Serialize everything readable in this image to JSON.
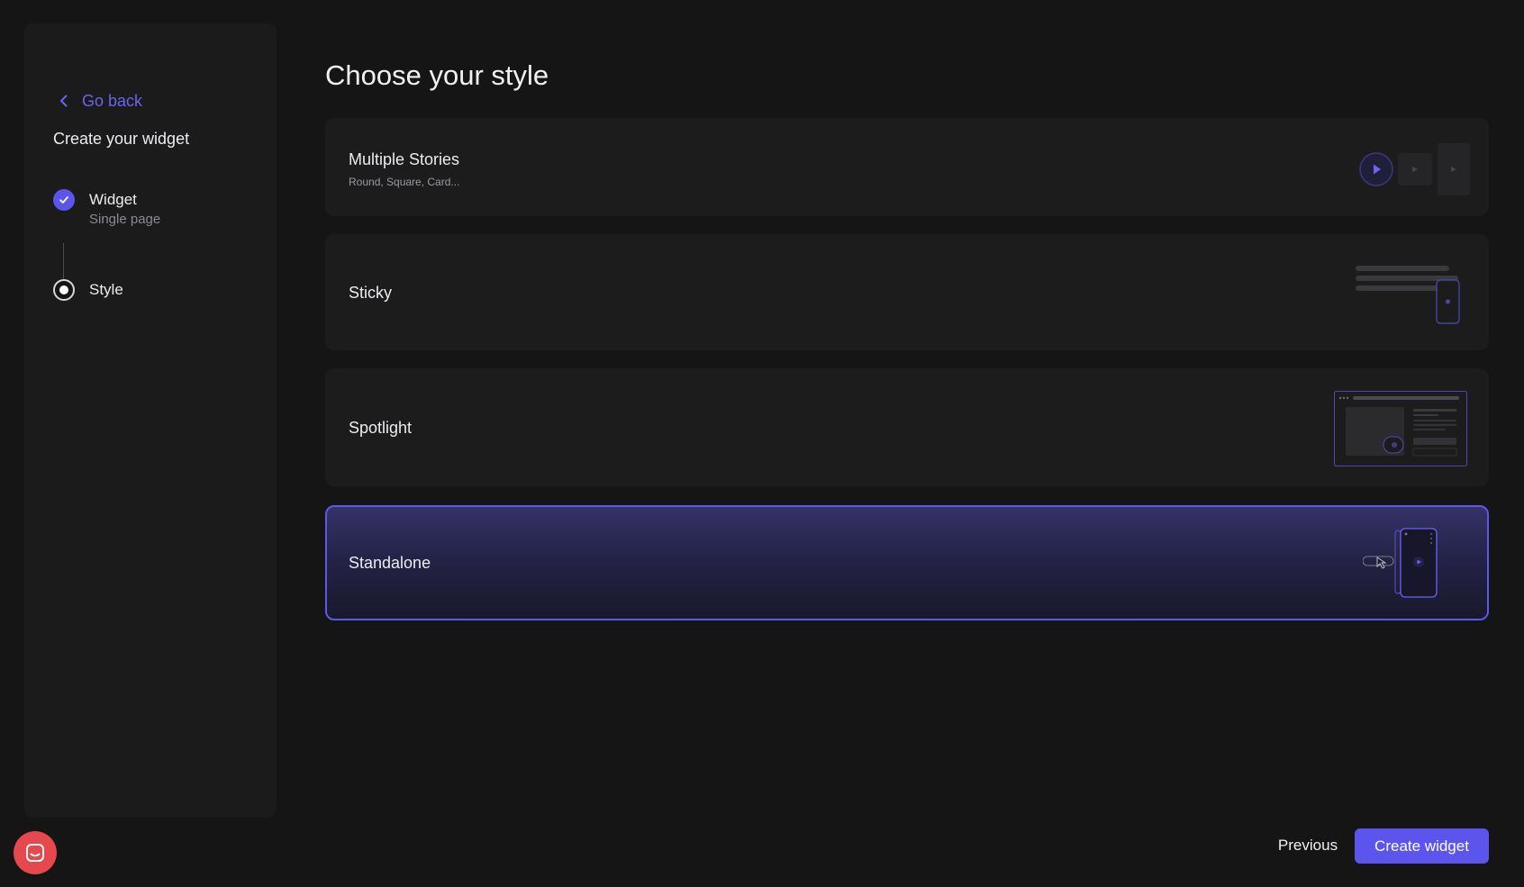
{
  "sidebar": {
    "back_label": "Go back",
    "title": "Create your widget",
    "steps": [
      {
        "label": "Widget",
        "sub": "Single page",
        "state": "done"
      },
      {
        "label": "Style",
        "sub": "",
        "state": "active"
      }
    ]
  },
  "main": {
    "title": "Choose your style",
    "options": [
      {
        "name": "Multiple Stories",
        "desc": "Round, Square, Card...",
        "selected": false
      },
      {
        "name": "Sticky",
        "desc": "",
        "selected": false
      },
      {
        "name": "Spotlight",
        "desc": "",
        "selected": false
      },
      {
        "name": "Standalone",
        "desc": "",
        "selected": true
      }
    ]
  },
  "footer": {
    "previous_label": "Previous",
    "create_label": "Create widget"
  },
  "colors": {
    "accent": "#5b55ee",
    "background": "#151516",
    "panel": "#1b1b1c",
    "chat_button": "#e5484d"
  },
  "icons": {
    "back": "chevron-left-icon",
    "step_done": "check-icon",
    "chat": "chat-icon"
  }
}
